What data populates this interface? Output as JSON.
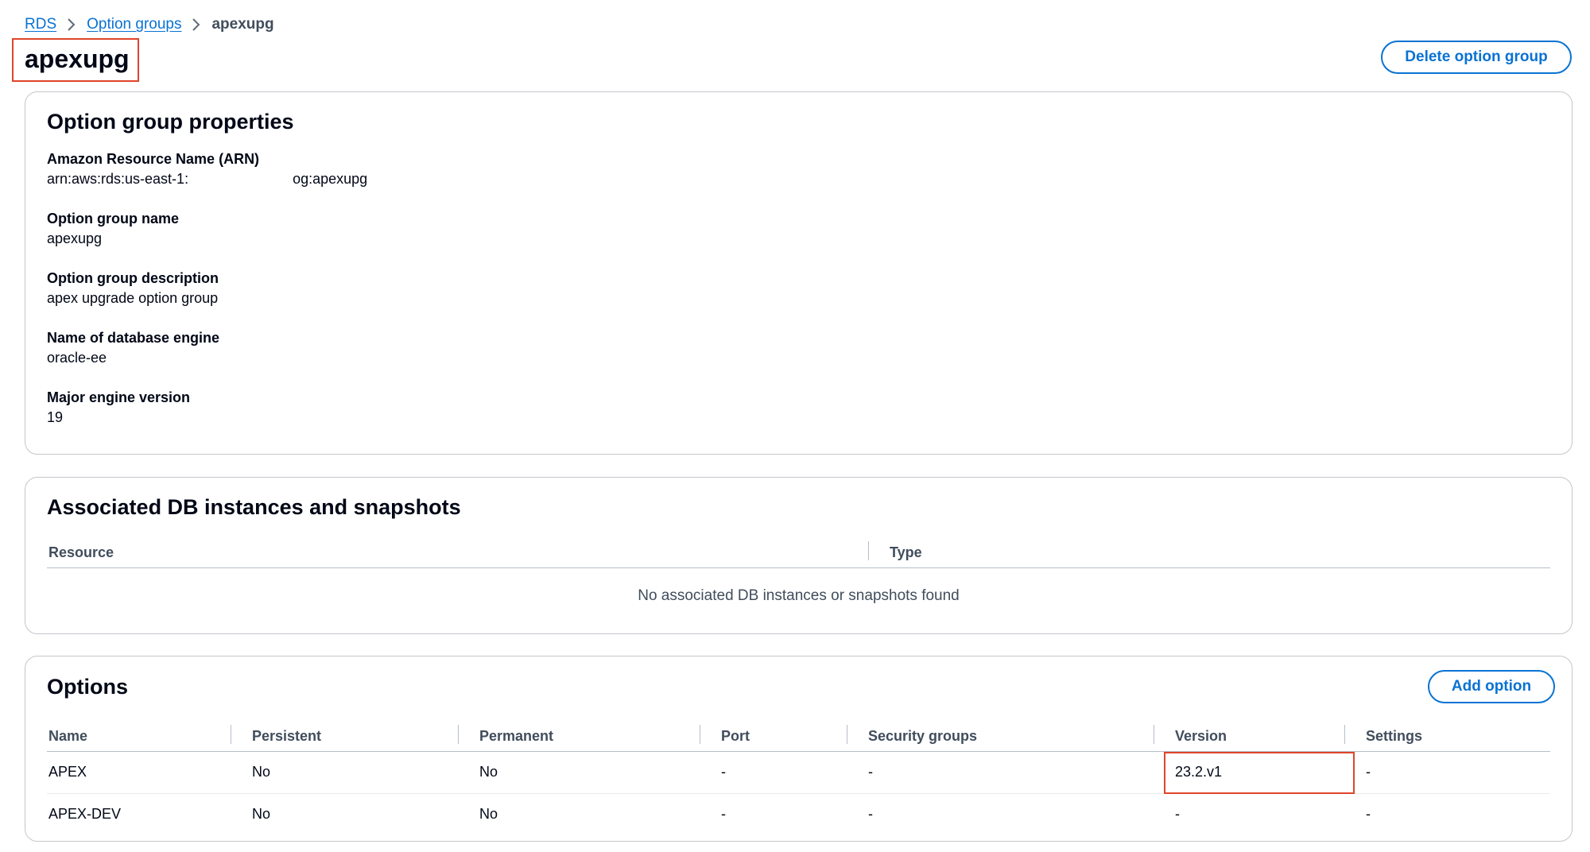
{
  "breadcrumb": {
    "items": [
      "RDS",
      "Option groups"
    ],
    "current": "apexupg"
  },
  "page": {
    "title": "apexupg",
    "delete_button": "Delete option group"
  },
  "properties": {
    "heading": "Option group properties",
    "fields": [
      {
        "label": "Amazon Resource Name (ARN)",
        "value": "arn:aws:rds:us-east-1:",
        "value_suffix": "og:apexupg"
      },
      {
        "label": "Option group name",
        "value": "apexupg"
      },
      {
        "label": "Option group description",
        "value": "apex upgrade option group"
      },
      {
        "label": "Name of database engine",
        "value": "oracle-ee"
      },
      {
        "label": "Major engine version",
        "value": "19"
      }
    ]
  },
  "associated": {
    "heading": "Associated DB instances and snapshots",
    "columns": [
      "Resource",
      "Type"
    ],
    "empty_message": "No associated DB instances or snapshots found"
  },
  "options": {
    "heading": "Options",
    "add_button": "Add option",
    "columns": [
      "Name",
      "Persistent",
      "Permanent",
      "Port",
      "Security groups",
      "Version",
      "Settings"
    ],
    "rows": [
      [
        "APEX",
        "No",
        "No",
        "-",
        "-",
        "23.2.v1",
        "-"
      ],
      [
        "APEX-DEV",
        "No",
        "No",
        "-",
        "-",
        "-",
        "-"
      ]
    ]
  },
  "colors": {
    "link": "#0972d3",
    "highlight": "#e0442b",
    "border": "#c6c6cd"
  },
  "icons": {
    "breadcrumb_separator": "chevron-right-icon"
  }
}
